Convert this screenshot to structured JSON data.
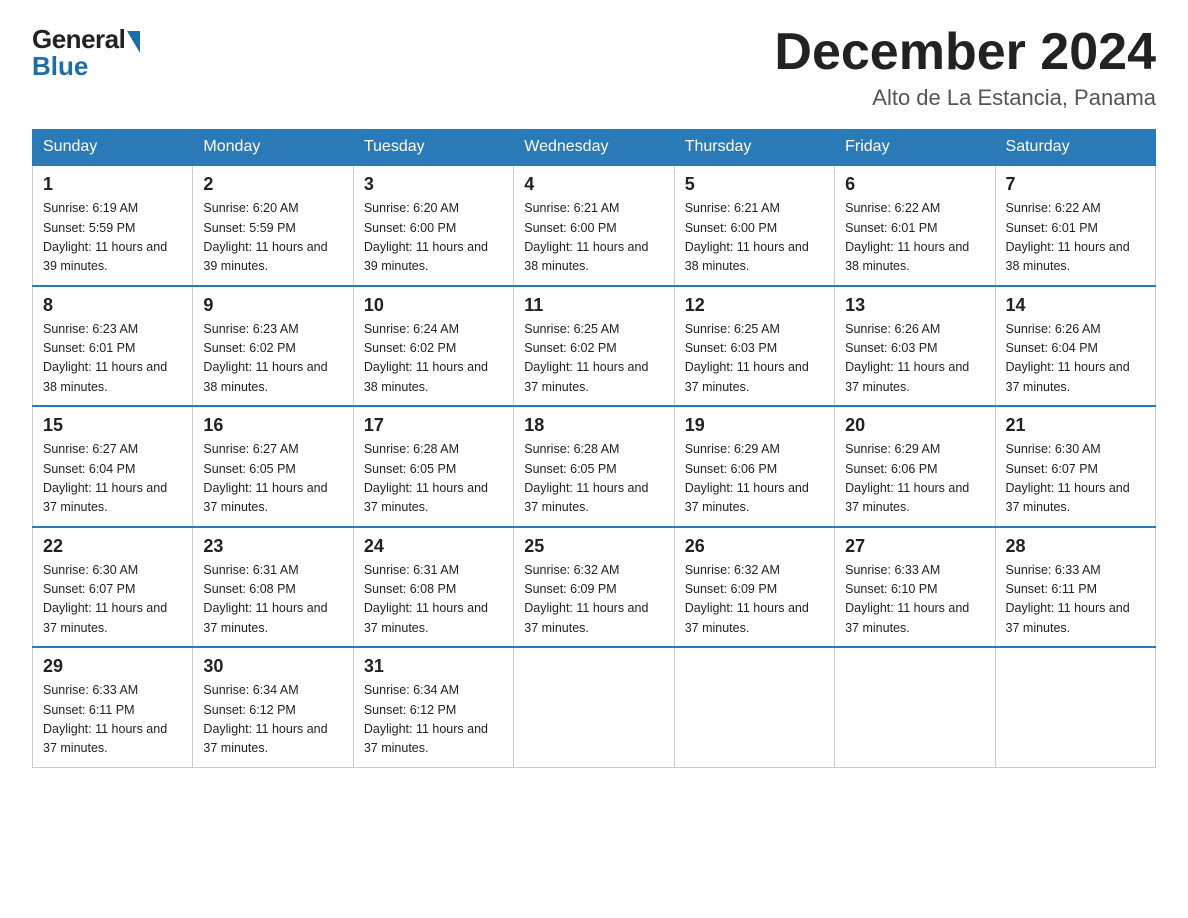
{
  "header": {
    "logo_general": "General",
    "logo_blue": "Blue",
    "month_title": "December 2024",
    "location": "Alto de La Estancia, Panama"
  },
  "days_of_week": [
    "Sunday",
    "Monday",
    "Tuesday",
    "Wednesday",
    "Thursday",
    "Friday",
    "Saturday"
  ],
  "weeks": [
    [
      {
        "day": "1",
        "sunrise": "6:19 AM",
        "sunset": "5:59 PM",
        "daylight": "11 hours and 39 minutes."
      },
      {
        "day": "2",
        "sunrise": "6:20 AM",
        "sunset": "5:59 PM",
        "daylight": "11 hours and 39 minutes."
      },
      {
        "day": "3",
        "sunrise": "6:20 AM",
        "sunset": "6:00 PM",
        "daylight": "11 hours and 39 minutes."
      },
      {
        "day": "4",
        "sunrise": "6:21 AM",
        "sunset": "6:00 PM",
        "daylight": "11 hours and 38 minutes."
      },
      {
        "day": "5",
        "sunrise": "6:21 AM",
        "sunset": "6:00 PM",
        "daylight": "11 hours and 38 minutes."
      },
      {
        "day": "6",
        "sunrise": "6:22 AM",
        "sunset": "6:01 PM",
        "daylight": "11 hours and 38 minutes."
      },
      {
        "day": "7",
        "sunrise": "6:22 AM",
        "sunset": "6:01 PM",
        "daylight": "11 hours and 38 minutes."
      }
    ],
    [
      {
        "day": "8",
        "sunrise": "6:23 AM",
        "sunset": "6:01 PM",
        "daylight": "11 hours and 38 minutes."
      },
      {
        "day": "9",
        "sunrise": "6:23 AM",
        "sunset": "6:02 PM",
        "daylight": "11 hours and 38 minutes."
      },
      {
        "day": "10",
        "sunrise": "6:24 AM",
        "sunset": "6:02 PM",
        "daylight": "11 hours and 38 minutes."
      },
      {
        "day": "11",
        "sunrise": "6:25 AM",
        "sunset": "6:02 PM",
        "daylight": "11 hours and 37 minutes."
      },
      {
        "day": "12",
        "sunrise": "6:25 AM",
        "sunset": "6:03 PM",
        "daylight": "11 hours and 37 minutes."
      },
      {
        "day": "13",
        "sunrise": "6:26 AM",
        "sunset": "6:03 PM",
        "daylight": "11 hours and 37 minutes."
      },
      {
        "day": "14",
        "sunrise": "6:26 AM",
        "sunset": "6:04 PM",
        "daylight": "11 hours and 37 minutes."
      }
    ],
    [
      {
        "day": "15",
        "sunrise": "6:27 AM",
        "sunset": "6:04 PM",
        "daylight": "11 hours and 37 minutes."
      },
      {
        "day": "16",
        "sunrise": "6:27 AM",
        "sunset": "6:05 PM",
        "daylight": "11 hours and 37 minutes."
      },
      {
        "day": "17",
        "sunrise": "6:28 AM",
        "sunset": "6:05 PM",
        "daylight": "11 hours and 37 minutes."
      },
      {
        "day": "18",
        "sunrise": "6:28 AM",
        "sunset": "6:05 PM",
        "daylight": "11 hours and 37 minutes."
      },
      {
        "day": "19",
        "sunrise": "6:29 AM",
        "sunset": "6:06 PM",
        "daylight": "11 hours and 37 minutes."
      },
      {
        "day": "20",
        "sunrise": "6:29 AM",
        "sunset": "6:06 PM",
        "daylight": "11 hours and 37 minutes."
      },
      {
        "day": "21",
        "sunrise": "6:30 AM",
        "sunset": "6:07 PM",
        "daylight": "11 hours and 37 minutes."
      }
    ],
    [
      {
        "day": "22",
        "sunrise": "6:30 AM",
        "sunset": "6:07 PM",
        "daylight": "11 hours and 37 minutes."
      },
      {
        "day": "23",
        "sunrise": "6:31 AM",
        "sunset": "6:08 PM",
        "daylight": "11 hours and 37 minutes."
      },
      {
        "day": "24",
        "sunrise": "6:31 AM",
        "sunset": "6:08 PM",
        "daylight": "11 hours and 37 minutes."
      },
      {
        "day": "25",
        "sunrise": "6:32 AM",
        "sunset": "6:09 PM",
        "daylight": "11 hours and 37 minutes."
      },
      {
        "day": "26",
        "sunrise": "6:32 AM",
        "sunset": "6:09 PM",
        "daylight": "11 hours and 37 minutes."
      },
      {
        "day": "27",
        "sunrise": "6:33 AM",
        "sunset": "6:10 PM",
        "daylight": "11 hours and 37 minutes."
      },
      {
        "day": "28",
        "sunrise": "6:33 AM",
        "sunset": "6:11 PM",
        "daylight": "11 hours and 37 minutes."
      }
    ],
    [
      {
        "day": "29",
        "sunrise": "6:33 AM",
        "sunset": "6:11 PM",
        "daylight": "11 hours and 37 minutes."
      },
      {
        "day": "30",
        "sunrise": "6:34 AM",
        "sunset": "6:12 PM",
        "daylight": "11 hours and 37 minutes."
      },
      {
        "day": "31",
        "sunrise": "6:34 AM",
        "sunset": "6:12 PM",
        "daylight": "11 hours and 37 minutes."
      },
      null,
      null,
      null,
      null
    ]
  ]
}
